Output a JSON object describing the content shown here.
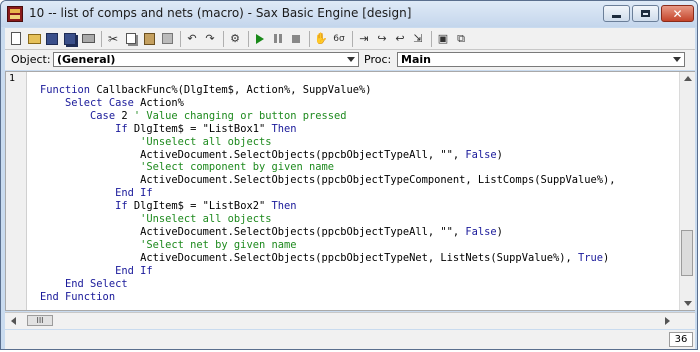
{
  "window": {
    "title": "10 -- list of comps and nets (macro) - Sax Basic Engine [design]",
    "icon": "app-icon",
    "controls": [
      "minimize-icon",
      "maximize-icon",
      "close-icon"
    ]
  },
  "toolbar": {
    "icons": [
      "new-file-icon",
      "open-folder-icon",
      "save-icon",
      "save-all-icon",
      "print-icon",
      "cut-icon",
      "copy-icon",
      "paste-icon",
      "delete-icon",
      "undo-icon",
      "redo-icon",
      "macro-icon",
      "run-icon",
      "pause-icon",
      "stop-icon",
      "hand-icon",
      "watch-icon",
      "step-into-icon",
      "step-over-icon",
      "step-out-icon",
      "step-to-cursor-icon",
      "dialog-editor-icon",
      "references-icon"
    ]
  },
  "objbar": {
    "object_label": "Object:",
    "object_value": "(General)",
    "proc_label": "Proc:",
    "proc_value": "Main"
  },
  "editor": {
    "gutter_number": "1",
    "lines": [
      [
        [
          "kw",
          "Function "
        ],
        [
          "st",
          "CallbackFunc%(DlgItem$, Action%, SuppValue%)"
        ]
      ],
      [
        [
          "kw",
          "    Select Case "
        ],
        [
          "st",
          "Action%"
        ]
      ],
      [
        [
          "kw",
          "        Case "
        ],
        [
          "st",
          "2 "
        ],
        [
          "cm",
          "' Value changing or button pressed"
        ]
      ],
      [
        [
          "kw",
          "            If "
        ],
        [
          "st",
          "DlgItem$ = \"ListBox1\" "
        ],
        [
          "kw",
          "Then"
        ]
      ],
      [
        [
          "cm",
          "                'Unselect all objects"
        ]
      ],
      [
        [
          "st",
          "                ActiveDocument.SelectObjects(ppcbObjectTypeAll, \"\", "
        ],
        [
          "kw",
          "False"
        ],
        [
          "st",
          ")"
        ]
      ],
      [
        [
          "cm",
          "                'Select component by given name"
        ]
      ],
      [
        [
          "st",
          "                ActiveDocument.SelectObjects(ppcbObjectTypeComponent, ListComps(SuppValue%),"
        ]
      ],
      [
        [
          "kw",
          "            End If"
        ]
      ],
      [
        [
          "kw",
          "            If "
        ],
        [
          "st",
          "DlgItem$ = \"ListBox2\" "
        ],
        [
          "kw",
          "Then"
        ]
      ],
      [
        [
          "cm",
          "                'Unselect all objects"
        ]
      ],
      [
        [
          "st",
          "                ActiveDocument.SelectObjects(ppcbObjectTypeAll, \"\", "
        ],
        [
          "kw",
          "False"
        ],
        [
          "st",
          ")"
        ]
      ],
      [
        [
          "cm",
          "                'Select net by given name"
        ]
      ],
      [
        [
          "st",
          "                ActiveDocument.SelectObjects(ppcbObjectTypeNet, ListNets(SuppValue%), "
        ],
        [
          "kw",
          "True"
        ],
        [
          "st",
          ")"
        ]
      ],
      [
        [
          "kw",
          "            End If"
        ]
      ],
      [
        [
          "kw",
          "    End Select"
        ]
      ],
      [
        [
          "kw",
          "End Function"
        ]
      ]
    ]
  },
  "hscroll": {
    "thumb_label": "III"
  },
  "status": {
    "line_number": "36"
  },
  "colors": {
    "keyword": "#1a1a9a",
    "comment": "#1e8a1e",
    "title_bar": "#c9dbef",
    "close_button": "#c4442a"
  }
}
